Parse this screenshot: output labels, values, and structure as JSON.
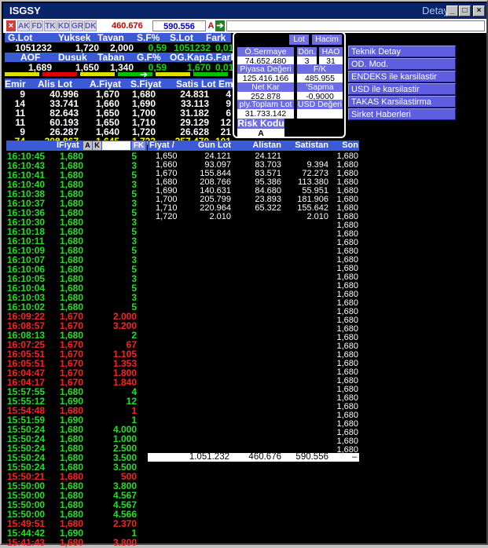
{
  "window": {
    "title": "ISGSY",
    "title_right": "Detay"
  },
  "toolbar": {
    "buttons": [
      "AK",
      "FD",
      "TK",
      "KD",
      "GR",
      "DK"
    ],
    "value_red": "460.676",
    "value_blue": "590.556",
    "a_label": "A"
  },
  "summary": {
    "headers1": [
      "G.Lot",
      "Yuksek",
      "Tavan",
      "S.F%",
      "S.Lot",
      "Fark"
    ],
    "values1": [
      "1051232",
      "1,720",
      "2,000",
      "0,59",
      "1051232",
      "0,010"
    ],
    "headers2": [
      "AOF",
      "Dusuk",
      "Taban",
      "G.F%",
      "OG.Kap.",
      "G.Fark"
    ],
    "values2": [
      "1,689",
      "1,650",
      "1,340",
      "0,59",
      "1,670",
      "0,010"
    ]
  },
  "depth": {
    "headers": [
      "Emir",
      "Alis Lot",
      "A.Fiyat",
      "S.Fiyat",
      "Satis Lot",
      "Emir"
    ],
    "rows": [
      [
        "9",
        "40.996",
        "1,670",
        "1,680",
        "24.831",
        "4"
      ],
      [
        "14",
        "33.741",
        "1,660",
        "1,690",
        "33.113",
        "9"
      ],
      [
        "11",
        "82.643",
        "1,650",
        "1,700",
        "31.182",
        "6"
      ],
      [
        "11",
        "60.193",
        "1,650",
        "1,710",
        "29.129",
        "12"
      ],
      [
        "9",
        "26.287",
        "1,640",
        "1,720",
        "26.628",
        "21"
      ]
    ],
    "total": [
      "74",
      "308.867",
      "1,645",
      "1,723",
      "257.470",
      "101"
    ]
  },
  "info": {
    "tabs": [
      "Lot",
      "Hacim"
    ],
    "osermaye_label": "Ö.Sermaye",
    "osermaye": "74.652.480",
    "don_label": "Dön.",
    "don": "3",
    "hao_label": "HAO",
    "hao": "31",
    "piyasa_label": "Piyasa Değeri",
    "piyasa": "125.416.166",
    "fk_label": "F/K",
    "fk": "485.955",
    "netkar_label": "Net Kar",
    "netkar": "252.878",
    "sapma_label": "'Sapma",
    "sapma": "-0,9000",
    "plylot_label": "ply.Toplam Lot",
    "plylot": "31.733.142",
    "usd_label": "USD Değeri",
    "risk_label": "Risk Kodu",
    "risk": "A"
  },
  "menu": [
    "Teknik Detay",
    "OD. Mod.",
    "ENDEKS ile karsilastir",
    "USD ile karsilastir",
    "TAKAS Karsilastirma",
    "Sirket Haberleri"
  ],
  "trades": {
    "headers": [
      "İFiyat",
      "A",
      "K",
      "",
      "FK"
    ],
    "rows": [
      [
        "16:10:45",
        "1,680",
        "5",
        "g"
      ],
      [
        "16:10:43",
        "1,680",
        "3",
        "g"
      ],
      [
        "16:10:41",
        "1,680",
        "5",
        "g"
      ],
      [
        "16:10:40",
        "1,680",
        "3",
        "g"
      ],
      [
        "16:10:38",
        "1,680",
        "5",
        "g"
      ],
      [
        "16:10:37",
        "1,680",
        "3",
        "g"
      ],
      [
        "16:10:36",
        "1,680",
        "5",
        "g"
      ],
      [
        "16:10:30",
        "1,680",
        "3",
        "g"
      ],
      [
        "16:10:18",
        "1,680",
        "5",
        "g"
      ],
      [
        "16:10:11",
        "1,680",
        "3",
        "g"
      ],
      [
        "16:10:09",
        "1,680",
        "5",
        "g"
      ],
      [
        "16:10:07",
        "1,680",
        "3",
        "g"
      ],
      [
        "16:10:06",
        "1,680",
        "5",
        "g"
      ],
      [
        "16:10:05",
        "1,680",
        "3",
        "g"
      ],
      [
        "16:10:04",
        "1,680",
        "5",
        "g"
      ],
      [
        "16:10:03",
        "1,680",
        "3",
        "g"
      ],
      [
        "16:10:02",
        "1,680",
        "5",
        "g"
      ],
      [
        "16:09:22",
        "1,670",
        "2.000",
        "r"
      ],
      [
        "16:08:57",
        "1,670",
        "3.200",
        "r"
      ],
      [
        "16:08:13",
        "1,680",
        "2",
        "g"
      ],
      [
        "16:07:25",
        "1,670",
        "67",
        "r"
      ],
      [
        "16:05:51",
        "1,670",
        "1.105",
        "r"
      ],
      [
        "16:05:51",
        "1,670",
        "1.353",
        "r"
      ],
      [
        "16:04:47",
        "1,670",
        "1.800",
        "r"
      ],
      [
        "16:04:17",
        "1,670",
        "1.840",
        "r"
      ],
      [
        "15:57:55",
        "1,680",
        "4",
        "g"
      ],
      [
        "15:55:12",
        "1,690",
        "12",
        "g"
      ],
      [
        "15:54:48",
        "1,680",
        "1",
        "r"
      ],
      [
        "15:51:59",
        "1,690",
        "1",
        "g"
      ],
      [
        "15:50:24",
        "1,680",
        "4.000",
        "g"
      ],
      [
        "15:50:24",
        "1,680",
        "1.000",
        "g"
      ],
      [
        "15:50:24",
        "1,680",
        "2.500",
        "g"
      ],
      [
        "15:50:24",
        "1,680",
        "3.500",
        "g"
      ],
      [
        "15:50:24",
        "1,680",
        "3.500",
        "g"
      ],
      [
        "15:50:21",
        "1,680",
        "500",
        "r"
      ],
      [
        "15:50:00",
        "1,680",
        "3.800",
        "g"
      ],
      [
        "15:50:00",
        "1,680",
        "4.567",
        "g"
      ],
      [
        "15:50:00",
        "1,680",
        "4.567",
        "g"
      ],
      [
        "15:50:00",
        "1,680",
        "4.566",
        "g"
      ],
      [
        "15:49:51",
        "1,680",
        "2.370",
        "r"
      ],
      [
        "15:44:42",
        "1,690",
        "1",
        "g"
      ],
      [
        "15:41:43",
        "1,680",
        "3.800",
        "r"
      ]
    ]
  },
  "distribution": {
    "headers": [
      "Fiyat",
      "Gun Lot",
      "Alistan",
      "Satistan",
      "Son"
    ],
    "rows": [
      [
        "1,650",
        "24.121",
        "24.121",
        ""
      ],
      [
        "1,660",
        "93.097",
        "83.703",
        "9.394"
      ],
      [
        "1,670",
        "155.844",
        "83.571",
        "72.273"
      ],
      [
        "1,680",
        "208.766",
        "95.386",
        "113.380"
      ],
      [
        "1,690",
        "140.631",
        "84.680",
        "55.951"
      ],
      [
        "1,700",
        "205.799",
        "23.893",
        "181.906"
      ],
      [
        "1,710",
        "220.964",
        "65.322",
        "155.642"
      ],
      [
        "1,720",
        "2.010",
        "",
        "2.010"
      ]
    ],
    "total": [
      "1.051.232",
      "460.676",
      "590.556"
    ],
    "son_value": "1,680"
  }
}
